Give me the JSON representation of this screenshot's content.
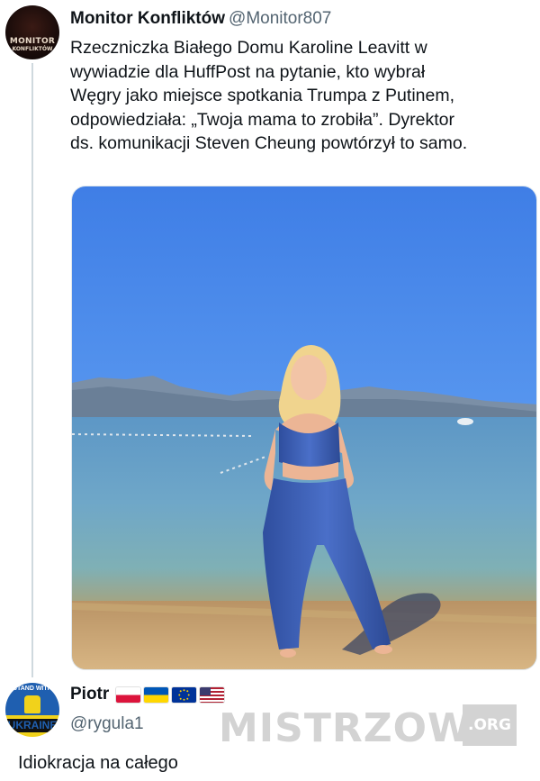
{
  "tweet": {
    "author": {
      "display_name": "Monitor Konfliktów",
      "handle": "@Monitor807",
      "avatar_text_line1": "MONITOR",
      "avatar_text_line2": "KONFLIKTÓW"
    },
    "text_lines": [
      "Rzeczniczka Białego Domu Karoline Leavitt w",
      "wywiadzie dla HuffPost na pytanie, kto wybrał",
      "Węgry jako miejsce spotkania Trumpa z Putinem,",
      "odpowiedziała: „Twoja mama to zrobiła”. Dyrektor",
      "ds. komunikacji Steven Cheung powtórzył to samo."
    ],
    "media": {
      "kind": "photo",
      "alt_icon": "photo-woman-lakeside-beach"
    }
  },
  "reply": {
    "author": {
      "display_name": "Piotr",
      "handle": "@rygula1",
      "flags": [
        "flag-poland-icon",
        "flag-ukraine-icon",
        "flag-eu-icon",
        "flag-usa-icon"
      ],
      "avatar_text_top": "STAND WITH",
      "avatar_text_bottom": "UKRAINE"
    },
    "text": "Idiokracja na całego"
  },
  "watermark": {
    "text": "MISTRZOWIE",
    "suffix": ".ORG"
  },
  "colors": {
    "text_primary": "#0f1419",
    "text_secondary": "#536471",
    "thread_line": "#cfd9de",
    "watermark": "#d3d3d3"
  }
}
